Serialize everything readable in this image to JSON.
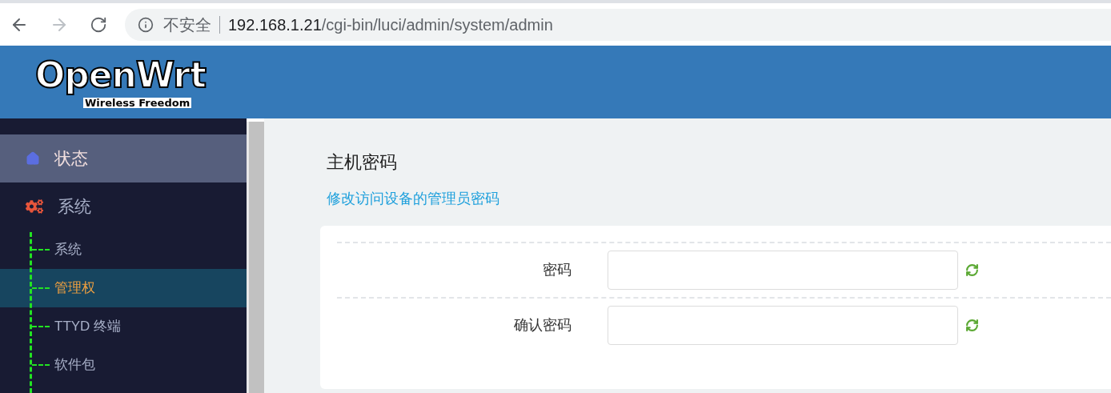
{
  "browser": {
    "security_label": "不安全",
    "url_host": "192.168.1.21",
    "url_path": "/cgi-bin/luci/admin/system/admin"
  },
  "logo": {
    "title": "OpenWrt",
    "tagline": "Wireless Freedom"
  },
  "sidebar": {
    "items": [
      {
        "label": "状态",
        "kind": "home",
        "selected": true
      },
      {
        "label": "系统",
        "kind": "system",
        "selected": false,
        "children": [
          {
            "label": "系统",
            "selected": false
          },
          {
            "label": "管理权",
            "selected": true
          },
          {
            "label": "TTYD 终端",
            "selected": false
          },
          {
            "label": "软件包",
            "selected": false
          }
        ]
      }
    ]
  },
  "page": {
    "title": "主机密码",
    "description": "修改访问设备的管理员密码"
  },
  "fields": [
    {
      "label": "密码"
    },
    {
      "label": "确认密码"
    }
  ]
}
